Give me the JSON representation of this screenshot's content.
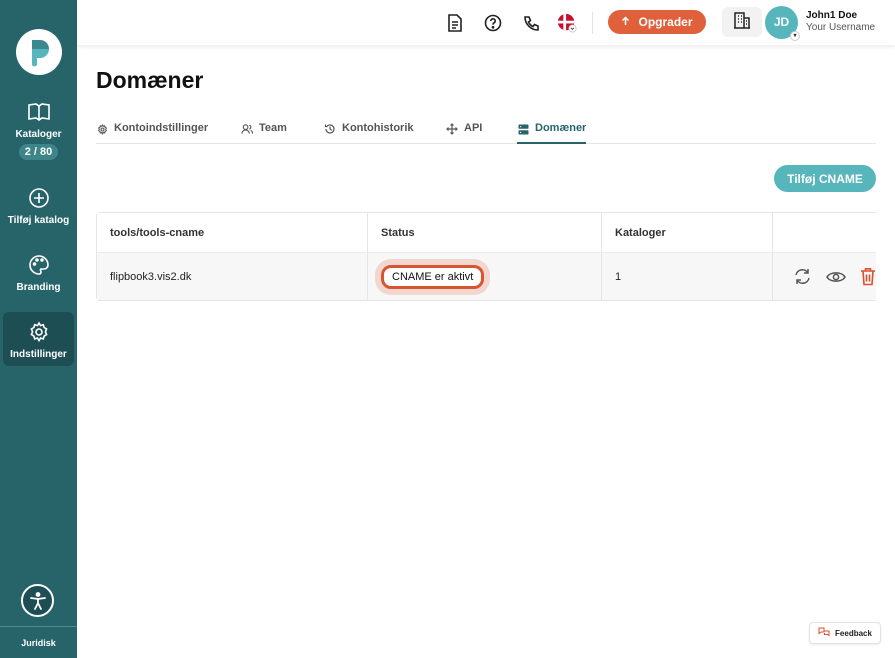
{
  "sidebar": {
    "logo_icon": "p-logo-icon",
    "items": [
      {
        "label": "Kataloger",
        "icon": "book-open-icon",
        "badge": "2 / 80"
      },
      {
        "label": "Tilføj katalog",
        "icon": "plus-circle-icon"
      },
      {
        "label": "Branding",
        "icon": "palette-icon"
      },
      {
        "label": "Indstillinger",
        "icon": "gear-icon",
        "active": true
      }
    ],
    "accessibility_icon": "accessibility-icon",
    "footer_link": "Juridisk"
  },
  "topbar": {
    "icons": [
      "document-icon",
      "help-icon",
      "phone-icon",
      "danish-flag-icon"
    ],
    "upgrade_label": "Opgrader",
    "org_icon": "building-icon",
    "user": {
      "initials": "JD",
      "name": "John1 Doe",
      "username": "Your Username"
    }
  },
  "page": {
    "title": "Domæner",
    "tabs": [
      {
        "label": "Kontoindstillinger",
        "icon": "gear-icon"
      },
      {
        "label": "Team",
        "icon": "users-icon"
      },
      {
        "label": "Kontohistorik",
        "icon": "history-icon"
      },
      {
        "label": "API",
        "icon": "move-icon"
      },
      {
        "label": "Domæner",
        "icon": "server-icon",
        "active": true
      }
    ],
    "add_button_label": "Tilføj CNAME"
  },
  "table": {
    "headers": [
      "tools/tools-cname",
      "Status",
      "Kataloger",
      ""
    ],
    "rows": [
      {
        "domain": "flipbook3.vis2.dk",
        "status": "CNAME er aktivt",
        "catalogs": "1"
      }
    ],
    "row_actions": [
      "refresh-icon",
      "eye-icon",
      "trash-icon"
    ]
  },
  "feedback_label": "Feedback",
  "colors": {
    "sidebar": "#26646a",
    "accent_teal": "#56b6bc",
    "upgrade_orange": "#e0603c",
    "status_highlight": "#d95530",
    "delete_red": "#d9502e"
  }
}
